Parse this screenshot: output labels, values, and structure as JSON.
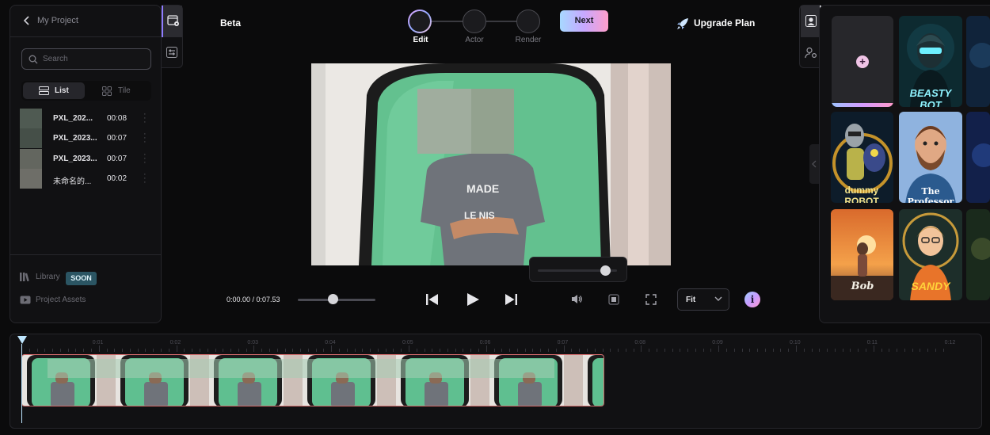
{
  "project": {
    "back_label": "My Project",
    "search_placeholder": "Search",
    "view_toggle": {
      "list": "List",
      "tile": "Tile"
    },
    "files": [
      {
        "name": "PXL_202...",
        "duration": "00:08"
      },
      {
        "name": "PXL_2023...",
        "duration": "00:07"
      },
      {
        "name": "PXL_2023...",
        "duration": "00:07"
      },
      {
        "name": "未命名的...",
        "duration": "00:02"
      }
    ],
    "library_label": "Library",
    "soon_badge": "SOON",
    "assets_label": "Project Assets"
  },
  "topbar": {
    "beta_label": "Beta",
    "steps": [
      "Edit",
      "Actor",
      "Render"
    ],
    "active_step": "Edit",
    "next_label": "Next",
    "upgrade_label": "Upgrade Plan"
  },
  "player": {
    "time": "0:00.00 / 0:07.53",
    "progress": 0.45,
    "volume": 0.85,
    "fit_option": "Fit",
    "info_symbol": "i"
  },
  "preview_shirt_text": [
    "MADE",
    "LE NIS"
  ],
  "avatars": [
    {
      "name": "",
      "style": "add"
    },
    {
      "name": "BEASTY BOT",
      "style": "beasty"
    },
    {
      "name": "dummy ROBOT",
      "style": "dummy"
    },
    {
      "name": "The Professor",
      "style": "professor"
    },
    {
      "name": "Bob",
      "style": "bob"
    },
    {
      "name": "SANDY",
      "style": "sandy"
    }
  ],
  "timeline": {
    "ticks": [
      "0:01",
      "0:02",
      "0:03",
      "0:04",
      "0:05",
      "0:06",
      "0:07",
      "0:08",
      "0:09",
      "0:10",
      "0:11",
      "0:12"
    ]
  },
  "colors": {
    "accent_gradient": [
      "#a7d8ff",
      "#c7a8ff",
      "#ff9ecb"
    ],
    "soon_badge_bg": "#2b5563",
    "green_screen": "#5fbf90"
  }
}
